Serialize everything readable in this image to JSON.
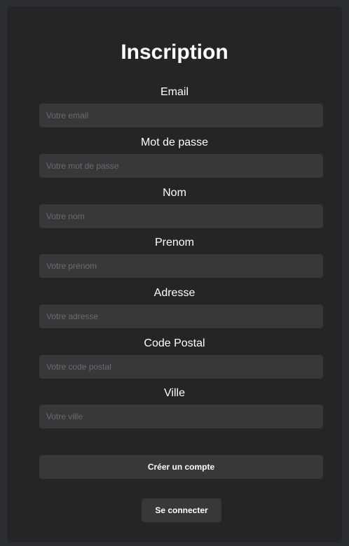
{
  "form": {
    "title": "Inscription",
    "fields": [
      {
        "label": "Email",
        "placeholder": "Votre email",
        "value": ""
      },
      {
        "label": "Mot de passe",
        "placeholder": "Votre mot de passe",
        "value": ""
      },
      {
        "label": "Nom",
        "placeholder": "Votre nom",
        "value": ""
      },
      {
        "label": "Prenom",
        "placeholder": "Votre prénom",
        "value": ""
      },
      {
        "label": "Adresse",
        "placeholder": "Votre adresse",
        "value": ""
      },
      {
        "label": "Code Postal",
        "placeholder": "Votre code postal",
        "value": ""
      },
      {
        "label": "Ville",
        "placeholder": "Votre ville",
        "value": ""
      }
    ],
    "create_label": "Créer un compte",
    "login_label": "Se connecter"
  },
  "colors": {
    "background": "#2b2e30",
    "card": "#252527",
    "input": "#38383b",
    "text": "#ffffff",
    "placeholder": "#6c6c70"
  }
}
